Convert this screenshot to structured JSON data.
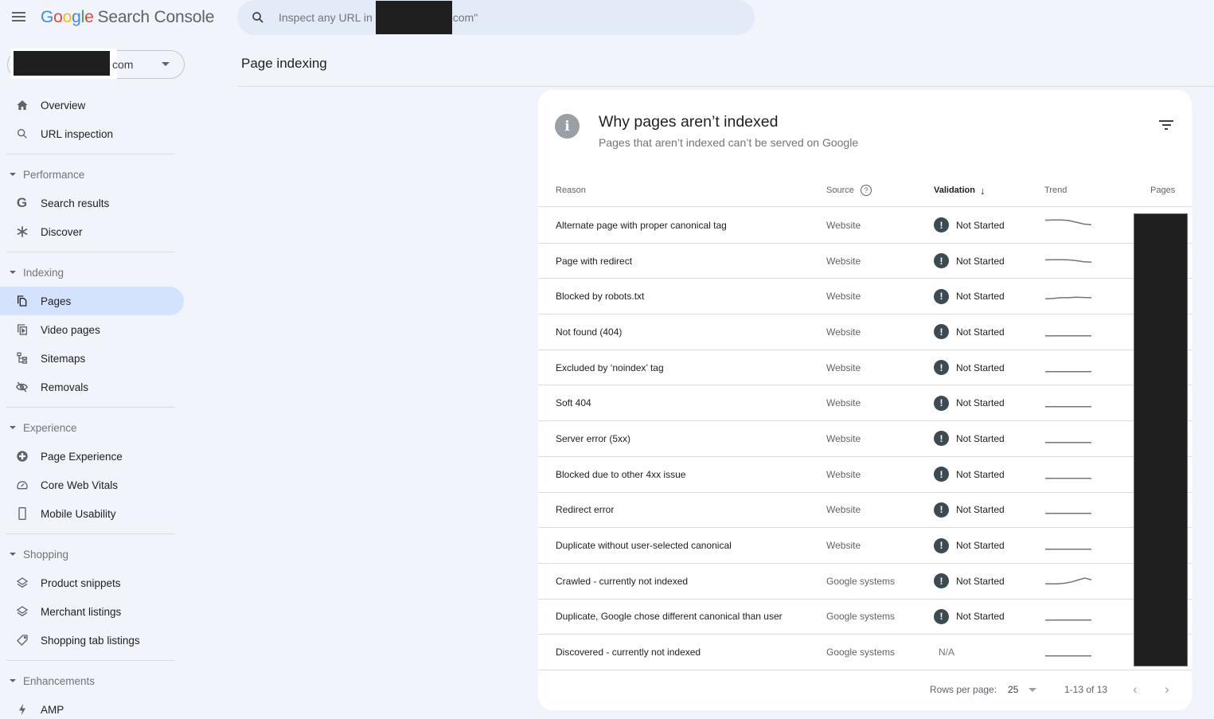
{
  "app": {
    "logo_letters": [
      "G",
      "o",
      "o",
      "g",
      "l",
      "e"
    ],
    "product_name": "Search Console",
    "menu_icon": "hamburger-menu-icon"
  },
  "search": {
    "placeholder_prefix": "Inspect any URL in",
    "placeholder_suffix": "com\"",
    "icon": "search-icon"
  },
  "property_selector": {
    "value_suffix": "com",
    "icon": "caret-down-icon"
  },
  "sidebar": {
    "top_items": [
      {
        "label": "Overview",
        "icon": "home-icon"
      },
      {
        "label": "URL inspection",
        "icon": "search-icon"
      }
    ],
    "sections": [
      {
        "label": "Performance",
        "items": [
          {
            "label": "Search results",
            "icon": "google-g-icon"
          },
          {
            "label": "Discover",
            "icon": "asterisk-icon"
          }
        ]
      },
      {
        "label": "Indexing",
        "items": [
          {
            "label": "Pages",
            "icon": "pages-icon",
            "active": true
          },
          {
            "label": "Video pages",
            "icon": "video-pages-icon"
          },
          {
            "label": "Sitemaps",
            "icon": "sitemap-icon"
          },
          {
            "label": "Removals",
            "icon": "eye-off-icon"
          }
        ]
      },
      {
        "label": "Experience",
        "items": [
          {
            "label": "Page Experience",
            "icon": "plus-circle-icon"
          },
          {
            "label": "Core Web Vitals",
            "icon": "speedometer-icon"
          },
          {
            "label": "Mobile Usability",
            "icon": "phone-icon"
          }
        ]
      },
      {
        "label": "Shopping",
        "items": [
          {
            "label": "Product snippets",
            "icon": "layers-icon"
          },
          {
            "label": "Merchant listings",
            "icon": "layers-icon"
          },
          {
            "label": "Shopping tab listings",
            "icon": "tag-icon"
          }
        ]
      },
      {
        "label": "Enhancements",
        "items": [
          {
            "label": "AMP",
            "icon": "bolt-icon"
          }
        ]
      }
    ]
  },
  "page": {
    "title": "Page indexing"
  },
  "card": {
    "title": "Why pages aren’t indexed",
    "subtitle": "Pages that aren’t indexed can’t be served on Google",
    "info_icon": "i",
    "filter_icon": "filter-icon",
    "columns": {
      "reason": "Reason",
      "source": "Source",
      "source_help": "?",
      "validation": "Validation",
      "validation_sort": "↓",
      "trend": "Trend",
      "pages": "Pages"
    },
    "rows": [
      {
        "reason": "Alternate page with proper canonical tag",
        "source": "Website",
        "validation": "Not Started",
        "status_icon": "!",
        "trend": [
          0.9,
          0.92,
          0.92,
          0.88,
          0.75,
          0.6,
          0.55
        ]
      },
      {
        "reason": "Page with redirect",
        "source": "Website",
        "validation": "Not Started",
        "status_icon": "!",
        "trend": [
          0.6,
          0.62,
          0.62,
          0.6,
          0.55,
          0.45,
          0.42
        ]
      },
      {
        "reason": "Blocked by robots.txt",
        "source": "Website",
        "validation": "Not Started",
        "status_icon": "!",
        "trend": [
          0.3,
          0.32,
          0.38,
          0.38,
          0.42,
          0.4,
          0.38
        ]
      },
      {
        "reason": "Not found (404)",
        "source": "Website",
        "validation": "Not Started",
        "status_icon": "!",
        "trend": [
          0.2,
          0.2,
          0.2,
          0.2,
          0.2,
          0.2,
          0.2
        ]
      },
      {
        "reason": "Excluded by ‘noindex’ tag",
        "source": "Website",
        "validation": "Not Started",
        "status_icon": "!",
        "trend": [
          0.2,
          0.2,
          0.2,
          0.2,
          0.2,
          0.2,
          0.2
        ]
      },
      {
        "reason": "Soft 404",
        "source": "Website",
        "validation": "Not Started",
        "status_icon": "!",
        "trend": [
          0.2,
          0.2,
          0.2,
          0.2,
          0.2,
          0.2,
          0.2
        ]
      },
      {
        "reason": "Server error (5xx)",
        "source": "Website",
        "validation": "Not Started",
        "status_icon": "!",
        "trend": [
          0.2,
          0.2,
          0.2,
          0.2,
          0.2,
          0.2,
          0.2
        ]
      },
      {
        "reason": "Blocked due to other 4xx issue",
        "source": "Website",
        "validation": "Not Started",
        "status_icon": "!",
        "trend": [
          0.2,
          0.2,
          0.2,
          0.2,
          0.2,
          0.2,
          0.2
        ]
      },
      {
        "reason": "Redirect error",
        "source": "Website",
        "validation": "Not Started",
        "status_icon": "!",
        "trend": [
          0.2,
          0.2,
          0.2,
          0.2,
          0.2,
          0.2,
          0.2
        ]
      },
      {
        "reason": "Duplicate without user-selected canonical",
        "source": "Website",
        "validation": "Not Started",
        "status_icon": "!",
        "trend": [
          0.2,
          0.2,
          0.2,
          0.2,
          0.2,
          0.2,
          0.2
        ]
      },
      {
        "reason": "Crawled - currently not indexed",
        "source": "Google systems",
        "validation": "Not Started",
        "status_icon": "!",
        "trend": [
          0.3,
          0.3,
          0.3,
          0.35,
          0.45,
          0.6,
          0.75,
          0.62
        ]
      },
      {
        "reason": "Duplicate, Google chose different canonical than user",
        "source": "Google systems",
        "validation": "Not Started",
        "status_icon": "!",
        "trend": [
          0.2,
          0.2,
          0.2,
          0.2,
          0.2,
          0.2,
          0.2
        ]
      },
      {
        "reason": "Discovered - currently not indexed",
        "source": "Google systems",
        "validation": "N/A",
        "status_icon": "",
        "trend": [
          0.2,
          0.2,
          0.2,
          0.2,
          0.2,
          0.2,
          0.2
        ]
      }
    ],
    "pager": {
      "rows_per_page_label": "Rows per page:",
      "rows_per_page_value": "25",
      "range": "1-13 of 13",
      "prev": "‹",
      "next": "›"
    }
  },
  "colors": {
    "background": "#f1f4fb",
    "search_bg": "#e3ebf8",
    "active_nav": "#d3e3fd",
    "status_icon": "#3c4a54",
    "trend_line": "#757575"
  }
}
